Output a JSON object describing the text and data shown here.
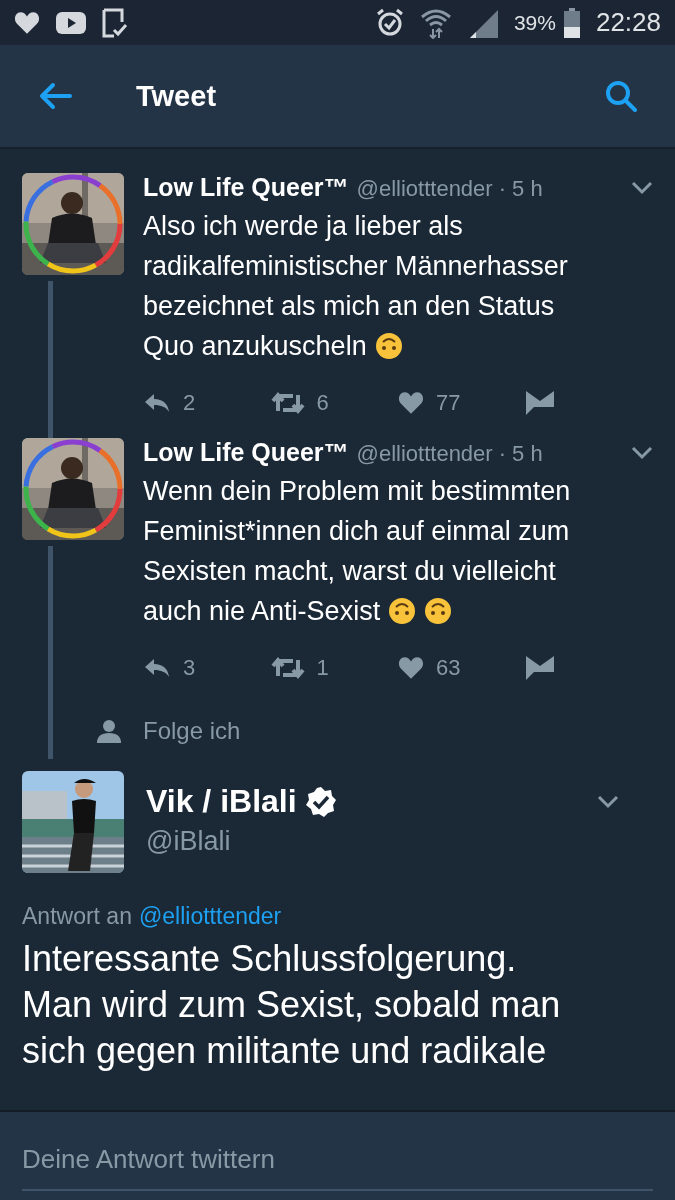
{
  "status_bar": {
    "battery": "39%",
    "time": "22:28"
  },
  "header": {
    "title": "Tweet"
  },
  "thread": [
    {
      "name": "Low Life Queer™",
      "handle": "@elliotttender",
      "age": "· 5 h",
      "text": "Also ich werde ja lieber als radikalfeministischer Männerhasser bezeichnet als mich an den Status Quo anzukuscheln",
      "emojis": [
        {
          "kind": "upside_down"
        }
      ],
      "replies": "2",
      "retweets": "6",
      "likes": "77"
    },
    {
      "name": "Low Life Queer™",
      "handle": "@elliotttender",
      "age": "· 5 h",
      "text": "Wenn dein Problem mit bestimmten Feminist*innen dich auf einmal zum Sexisten macht, warst du vielleicht auch nie Anti-Sexist",
      "emojis": [
        {
          "kind": "upside_down"
        },
        {
          "kind": "upside_down"
        }
      ],
      "replies": "3",
      "retweets": "1",
      "likes": "63"
    }
  ],
  "social_context": "Folge ich",
  "main_tweet": {
    "name": "Vik / iBlali",
    "verified": true,
    "handle": "@iBlali",
    "reply_label": "Antwort an",
    "reply_to": "@elliotttender",
    "text": "Interessante Schlussfolgerung. Man wird zum Sexist, sobald man sich gegen militante und radikale"
  },
  "reply_box": {
    "placeholder": "Deine Antwort twittern"
  }
}
